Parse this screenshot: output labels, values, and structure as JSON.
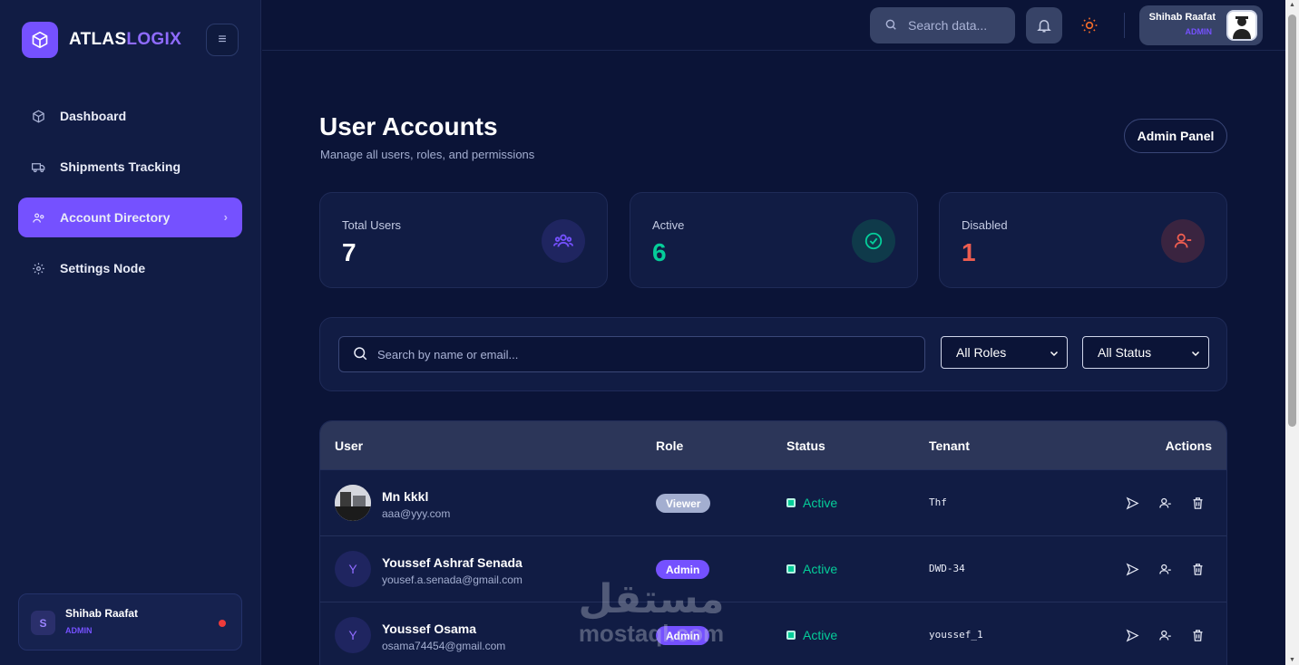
{
  "brand": {
    "part1": "ATLAS",
    "part2": "LOGIX",
    "menu_icon": "hamburger-icon"
  },
  "sidebar": {
    "items": [
      {
        "label": "Dashboard",
        "icon": "cube-icon",
        "active": false
      },
      {
        "label": "Shipments Tracking",
        "icon": "truck-icon",
        "active": false
      },
      {
        "label": "Account Directory",
        "icon": "users-cog-icon",
        "active": true
      },
      {
        "label": "Settings Node",
        "icon": "gear-icon",
        "active": false
      }
    ],
    "user": {
      "initial": "S",
      "name": "Shihab Raafat",
      "role": "ADMIN"
    }
  },
  "topbar": {
    "search_placeholder": "Search data...",
    "user": {
      "name": "Shihab Raafat",
      "role": "ADMIN"
    }
  },
  "page": {
    "title": "User Accounts",
    "subtitle": "Manage all users, roles, and permissions",
    "admin_button": "Admin Panel"
  },
  "stats": [
    {
      "label": "Total Users",
      "value": "7",
      "color": "#ffffff",
      "icon": "users-icon"
    },
    {
      "label": "Active",
      "value": "6",
      "color": "#05cd99",
      "icon": "check-circle-icon"
    },
    {
      "label": "Disabled",
      "value": "1",
      "color": "#ee5d50",
      "icon": "user-minus-icon"
    }
  ],
  "filters": {
    "search_placeholder": "Search by name or email...",
    "role_select": "All Roles",
    "status_select": "All Status"
  },
  "table": {
    "headers": {
      "user": "User",
      "role": "Role",
      "status": "Status",
      "tenant": "Tenant",
      "actions": "Actions"
    },
    "rows": [
      {
        "initial": "",
        "name": "Mn kkkl",
        "email": "aaa@yyy.com",
        "role": "Viewer",
        "status": "Active",
        "tenant": "Thf"
      },
      {
        "initial": "Y",
        "name": "Youssef Ashraf Senada",
        "email": "yousef.a.senada@gmail.com",
        "role": "Admin",
        "status": "Active",
        "tenant": "DWD-34"
      },
      {
        "initial": "Y",
        "name": "Youssef Osama",
        "email": "osama74454@gmail.com",
        "role": "Admin",
        "status": "Active",
        "tenant": "youssef_1"
      }
    ]
  },
  "watermark": {
    "arabic": "مستقل",
    "latin": "mostaql.com"
  }
}
